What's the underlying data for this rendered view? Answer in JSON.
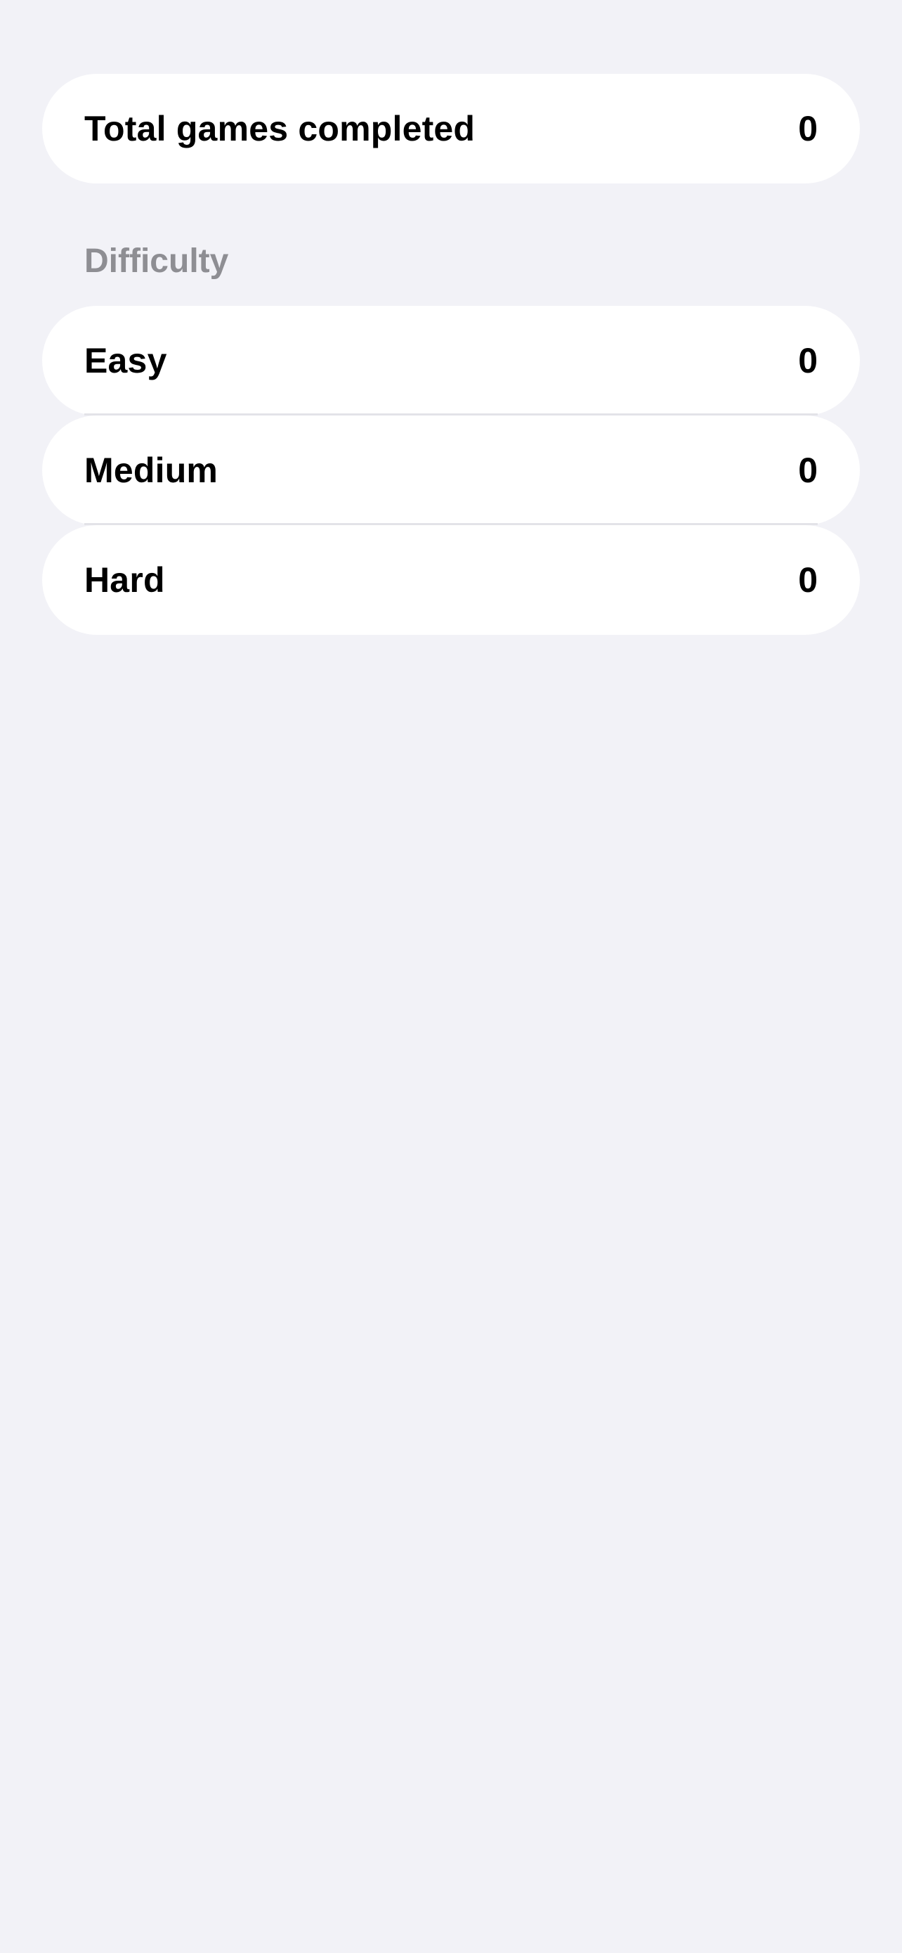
{
  "summary": {
    "label": "Total games completed",
    "value": "0"
  },
  "difficulty_section": {
    "header": "Difficulty",
    "items": [
      {
        "label": "Easy",
        "value": "0"
      },
      {
        "label": "Medium",
        "value": "0"
      },
      {
        "label": "Hard",
        "value": "0"
      }
    ]
  },
  "colors": {
    "background": "#f2f2f7",
    "card": "#ffffff",
    "primary_text": "#000000",
    "secondary_text": "#8e8e93",
    "separator": "#e3e3e8"
  }
}
